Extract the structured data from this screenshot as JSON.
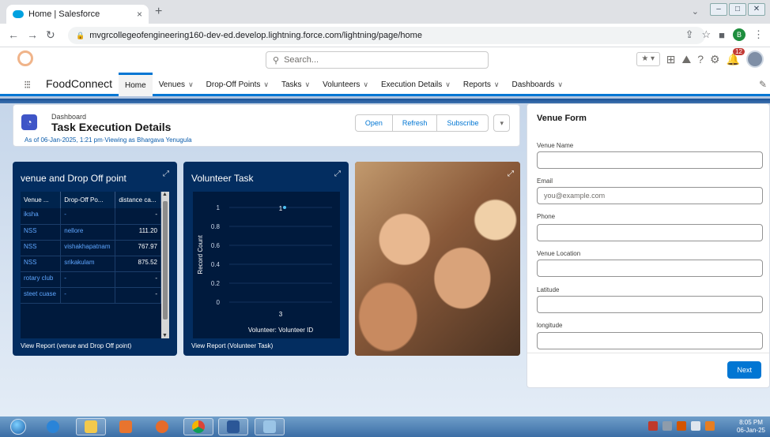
{
  "browser": {
    "tab_title": "Home | Salesforce",
    "tab_close": "×",
    "new_tab": "+",
    "url": "mvgrcollegeofengineering160-dev-ed.develop.lightning.force.com/lightning/page/home",
    "profile_initial": "B"
  },
  "sf": {
    "search_placeholder": "Search...",
    "notifications_count": "12",
    "app_name": "FoodConnect",
    "nav": [
      {
        "label": "Home",
        "active": true
      },
      {
        "label": "Venues"
      },
      {
        "label": "Drop-Off Points"
      },
      {
        "label": "Tasks"
      },
      {
        "label": "Volunteers"
      },
      {
        "label": "Execution Details"
      },
      {
        "label": "Reports"
      },
      {
        "label": "Dashboards"
      }
    ]
  },
  "dashboard": {
    "eyebrow": "Dashboard",
    "title": "Task Execution Details",
    "subtitle": "As of 06-Jan-2025, 1:21 pm·Viewing as Bhargava Yenugula",
    "buttons": {
      "open": "Open",
      "refresh": "Refresh",
      "subscribe": "Subscribe"
    }
  },
  "widget1": {
    "title": "venue and Drop Off point",
    "columns": [
      "Venue ...",
      "Drop-Off Po...",
      "distance ca..."
    ],
    "rows": [
      [
        "iksha",
        "-",
        "-"
      ],
      [
        "NSS",
        "nellore",
        "111.20"
      ],
      [
        "NSS",
        "vishakhapatnam",
        "767.97"
      ],
      [
        "NSS",
        "srikakulam",
        "875.52"
      ],
      [
        "rotary club",
        "-",
        "-"
      ],
      [
        "steet cuase",
        "-",
        "-"
      ]
    ],
    "footer": "View Report (venue and Drop Off point)"
  },
  "widget2": {
    "title": "Volunteer Task",
    "footer": "View Report (Volunteer Task)"
  },
  "chart_data": {
    "type": "scatter",
    "title": "Volunteer Task",
    "xlabel": "Volunteer: Volunteer ID",
    "ylabel": "Record Count",
    "categories": [
      "3"
    ],
    "values": [
      1
    ],
    "data_labels": [
      "1"
    ],
    "yticks": [
      "1",
      "0.8",
      "0.6",
      "0.4",
      "0.2",
      "0"
    ],
    "ylim": [
      0,
      1
    ]
  },
  "form": {
    "title": "Venue Form",
    "fields": [
      {
        "label": "Venue Name",
        "value": ""
      },
      {
        "label": "Email",
        "placeholder": "you@example.com"
      },
      {
        "label": "Phone",
        "value": ""
      },
      {
        "label": "Venue Location",
        "value": ""
      },
      {
        "label": "Latitude",
        "value": ""
      },
      {
        "label": "longitude",
        "value": ""
      }
    ],
    "next": "Next"
  },
  "taskbar": {
    "time": "8:05 PM",
    "date": "06-Jan-25"
  }
}
